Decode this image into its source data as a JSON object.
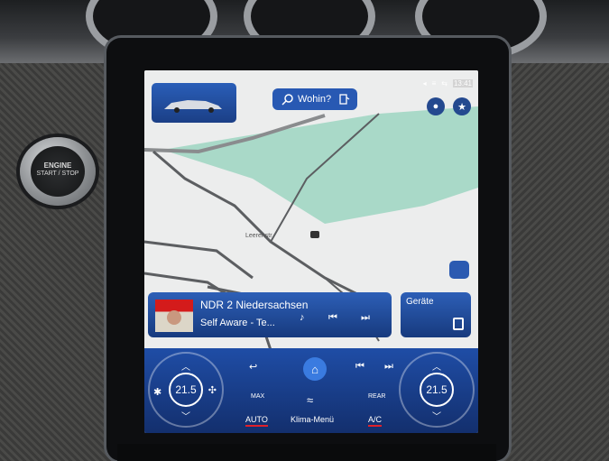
{
  "status_bar": {
    "time": "13:41"
  },
  "search": {
    "label": "Wohin?"
  },
  "map": {
    "street_name": "Leerenstr"
  },
  "media": {
    "station": "NDR 2 Niedersachsen",
    "track": "Self Aware - Te..."
  },
  "devices": {
    "label": "Geräte"
  },
  "climate": {
    "left_temp": "21.5",
    "right_temp": "21.5",
    "auto_label": "AUTO",
    "menu_label": "Klima-Menü",
    "ac_label": "A/C",
    "max_label": "MAX",
    "rear_label": "REAR"
  },
  "engine_button": {
    "line1": "ENGINE",
    "line2": "START / STOP"
  },
  "colors": {
    "accent": "#2859b3",
    "map_green": "#a9d9c8",
    "underline_red": "#e0202a"
  },
  "icons": [
    "search-icon",
    "fuel-icon",
    "profile-icon",
    "star-icon",
    "home-icon",
    "back-icon",
    "prev-icon",
    "next-icon",
    "phone-icon",
    "fan-icon"
  ]
}
